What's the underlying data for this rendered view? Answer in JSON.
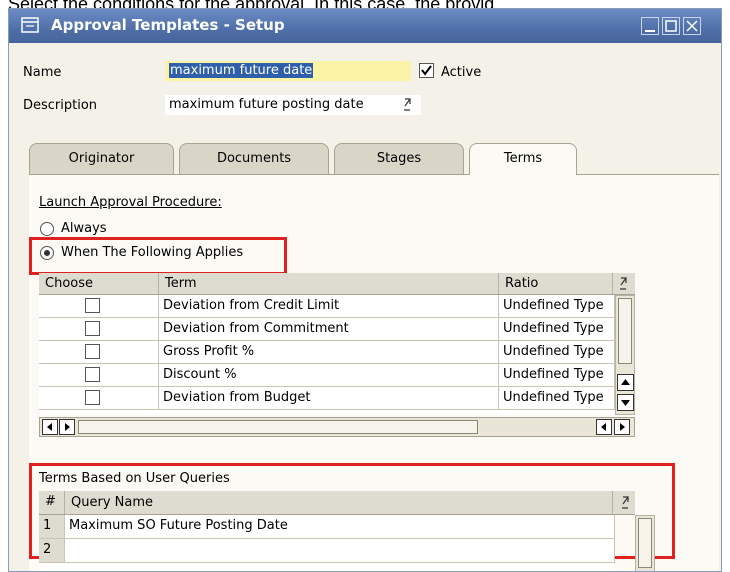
{
  "caption": "Select the conditions for the approval. In this case, the provid",
  "window": {
    "title": "Approval Templates - Setup",
    "controls": {
      "minimize": "minimize",
      "maximize": "maximize",
      "close": "close"
    }
  },
  "form": {
    "name_label": "Name",
    "name_value": "maximum future date",
    "active_label": "Active",
    "active_checked": true,
    "description_label": "Description",
    "description_value": "maximum future posting date"
  },
  "tabs": [
    {
      "label": "Originator",
      "active": false
    },
    {
      "label": "Documents",
      "active": false
    },
    {
      "label": "Stages",
      "active": false
    },
    {
      "label": "Terms",
      "active": true
    }
  ],
  "terms": {
    "launch_label": "Launch Approval Procedure:",
    "option_always": "Always",
    "option_when": "When The Following Applies",
    "selected": "when",
    "grid": {
      "headers": {
        "choose": "Choose",
        "term": "Term",
        "ratio": "Ratio"
      },
      "rows": [
        {
          "term": "Deviation from Credit Limit",
          "ratio": "Undefined Type"
        },
        {
          "term": "Deviation from Commitment",
          "ratio": "Undefined Type"
        },
        {
          "term": "Gross Profit %",
          "ratio": "Undefined Type"
        },
        {
          "term": "Discount %",
          "ratio": "Undefined Type"
        },
        {
          "term": "Deviation from Budget",
          "ratio": "Undefined Type"
        }
      ]
    },
    "user_queries": {
      "section_label": "Terms Based on User Queries",
      "headers": {
        "number": "#",
        "query_name": "Query Name"
      },
      "rows": [
        {
          "number": "1",
          "query_name": "Maximum SO Future Posting Date"
        },
        {
          "number": "2",
          "query_name": ""
        }
      ]
    }
  },
  "colors": {
    "titlebar": "#4f6fa8",
    "name_field_bg": "#fbf3a5",
    "highlight": "#e0211f",
    "window_bg": "#f3f1e8"
  },
  "icons": {
    "window": "window-icon",
    "link": "link-arrow-icon",
    "scroll_up": "scroll-up-icon",
    "scroll_down": "scroll-down-icon",
    "scroll_left": "scroll-left-icon",
    "scroll_right": "scroll-right-icon"
  }
}
